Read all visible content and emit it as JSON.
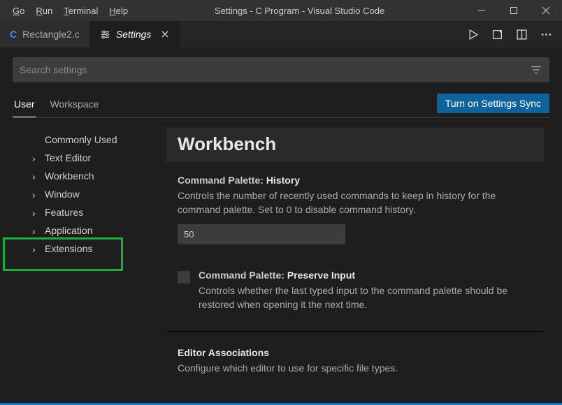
{
  "window": {
    "title": "Settings - C Program - Visual Studio Code"
  },
  "menubar": {
    "go": "Go",
    "run": "Run",
    "terminal": "Terminal",
    "help": "Help"
  },
  "tabs": {
    "file": {
      "label": "Rectangle2.c"
    },
    "settings": {
      "label": "Settings"
    }
  },
  "search": {
    "placeholder": "Search settings"
  },
  "scope": {
    "user": "User",
    "workspace": "Workspace",
    "sync_btn": "Turn on Settings Sync"
  },
  "tree": {
    "commonly_used": "Commonly Used",
    "text_editor": "Text Editor",
    "workbench": "Workbench",
    "window": "Window",
    "features": "Features",
    "application": "Application",
    "extensions": "Extensions"
  },
  "main": {
    "section_title": "Workbench",
    "history": {
      "prefix": "Command Palette: ",
      "name": "History",
      "desc": "Controls the number of recently used commands to keep in history for the command palette. Set to 0 to disable command history.",
      "value": "50"
    },
    "preserve": {
      "prefix": "Command Palette: ",
      "name": "Preserve Input",
      "desc": "Controls whether the last typed input to the command palette should be restored when opening it the next time."
    },
    "assoc": {
      "name": "Editor Associations",
      "desc": "Configure which editor to use for specific file types."
    }
  }
}
